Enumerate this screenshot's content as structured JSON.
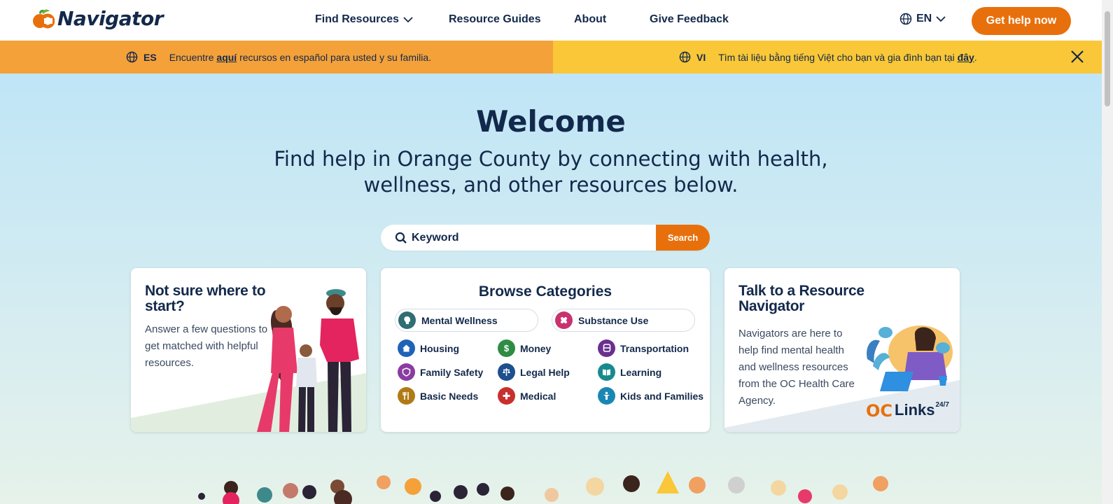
{
  "header": {
    "logo_text": "Navigator",
    "nav": [
      {
        "label": "Find Resources",
        "has_dropdown": true
      },
      {
        "label": "Resource Guides"
      },
      {
        "label": "About"
      },
      {
        "label": "Give Feedback"
      }
    ],
    "language": "EN",
    "cta_label": "Get help now"
  },
  "banner": {
    "es": {
      "code": "ES",
      "before": "Encuentre ",
      "link": "aquí",
      "after": " recursos en español para usted y su familia."
    },
    "vi": {
      "code": "VI",
      "before": "Tìm tài liệu bằng tiếng Việt cho bạn và gia đình bạn tại ",
      "link": "đây",
      "after": "."
    }
  },
  "hero": {
    "title": "Welcome",
    "subtitle": "Find help in Orange County by connecting with health, wellness, and other resources below."
  },
  "search": {
    "placeholder": "Keyword",
    "button_label": "Search"
  },
  "cards": {
    "start": {
      "title": "Not sure where to start?",
      "body": "Answer a few questions to get matched with helpful resources."
    },
    "categories": {
      "title": "Browse Categories",
      "featured": [
        {
          "label": "Mental Wellness",
          "color": "#2e6e74"
        },
        {
          "label": "Substance Use",
          "color": "#c8336f"
        }
      ],
      "items": [
        {
          "label": "Housing",
          "color": "#1f63b8"
        },
        {
          "label": "Money",
          "color": "#2e8c44"
        },
        {
          "label": "Transportation",
          "color": "#6a2f8f"
        },
        {
          "label": "Family Safety",
          "color": "#8a3ca0"
        },
        {
          "label": "Legal Help",
          "color": "#1e4f8e"
        },
        {
          "label": "Learning",
          "color": "#178a8f"
        },
        {
          "label": "Basic Needs",
          "color": "#b07a14"
        },
        {
          "label": "Medical",
          "color": "#c8302e"
        },
        {
          "label": "Kids and Families",
          "color": "#1a86b3"
        }
      ]
    },
    "navigator": {
      "title": "Talk to a Resource Navigator",
      "body": "Navigators are here to help find mental health and wellness resources from the OC Health Care Agency.",
      "logo_text": "Links",
      "logo_super": "24/7"
    }
  },
  "colors": {
    "brand_orange": "#e8700c",
    "navy": "#13294b",
    "banner_es": "#f4a13a",
    "banner_vi": "#f9c737"
  }
}
